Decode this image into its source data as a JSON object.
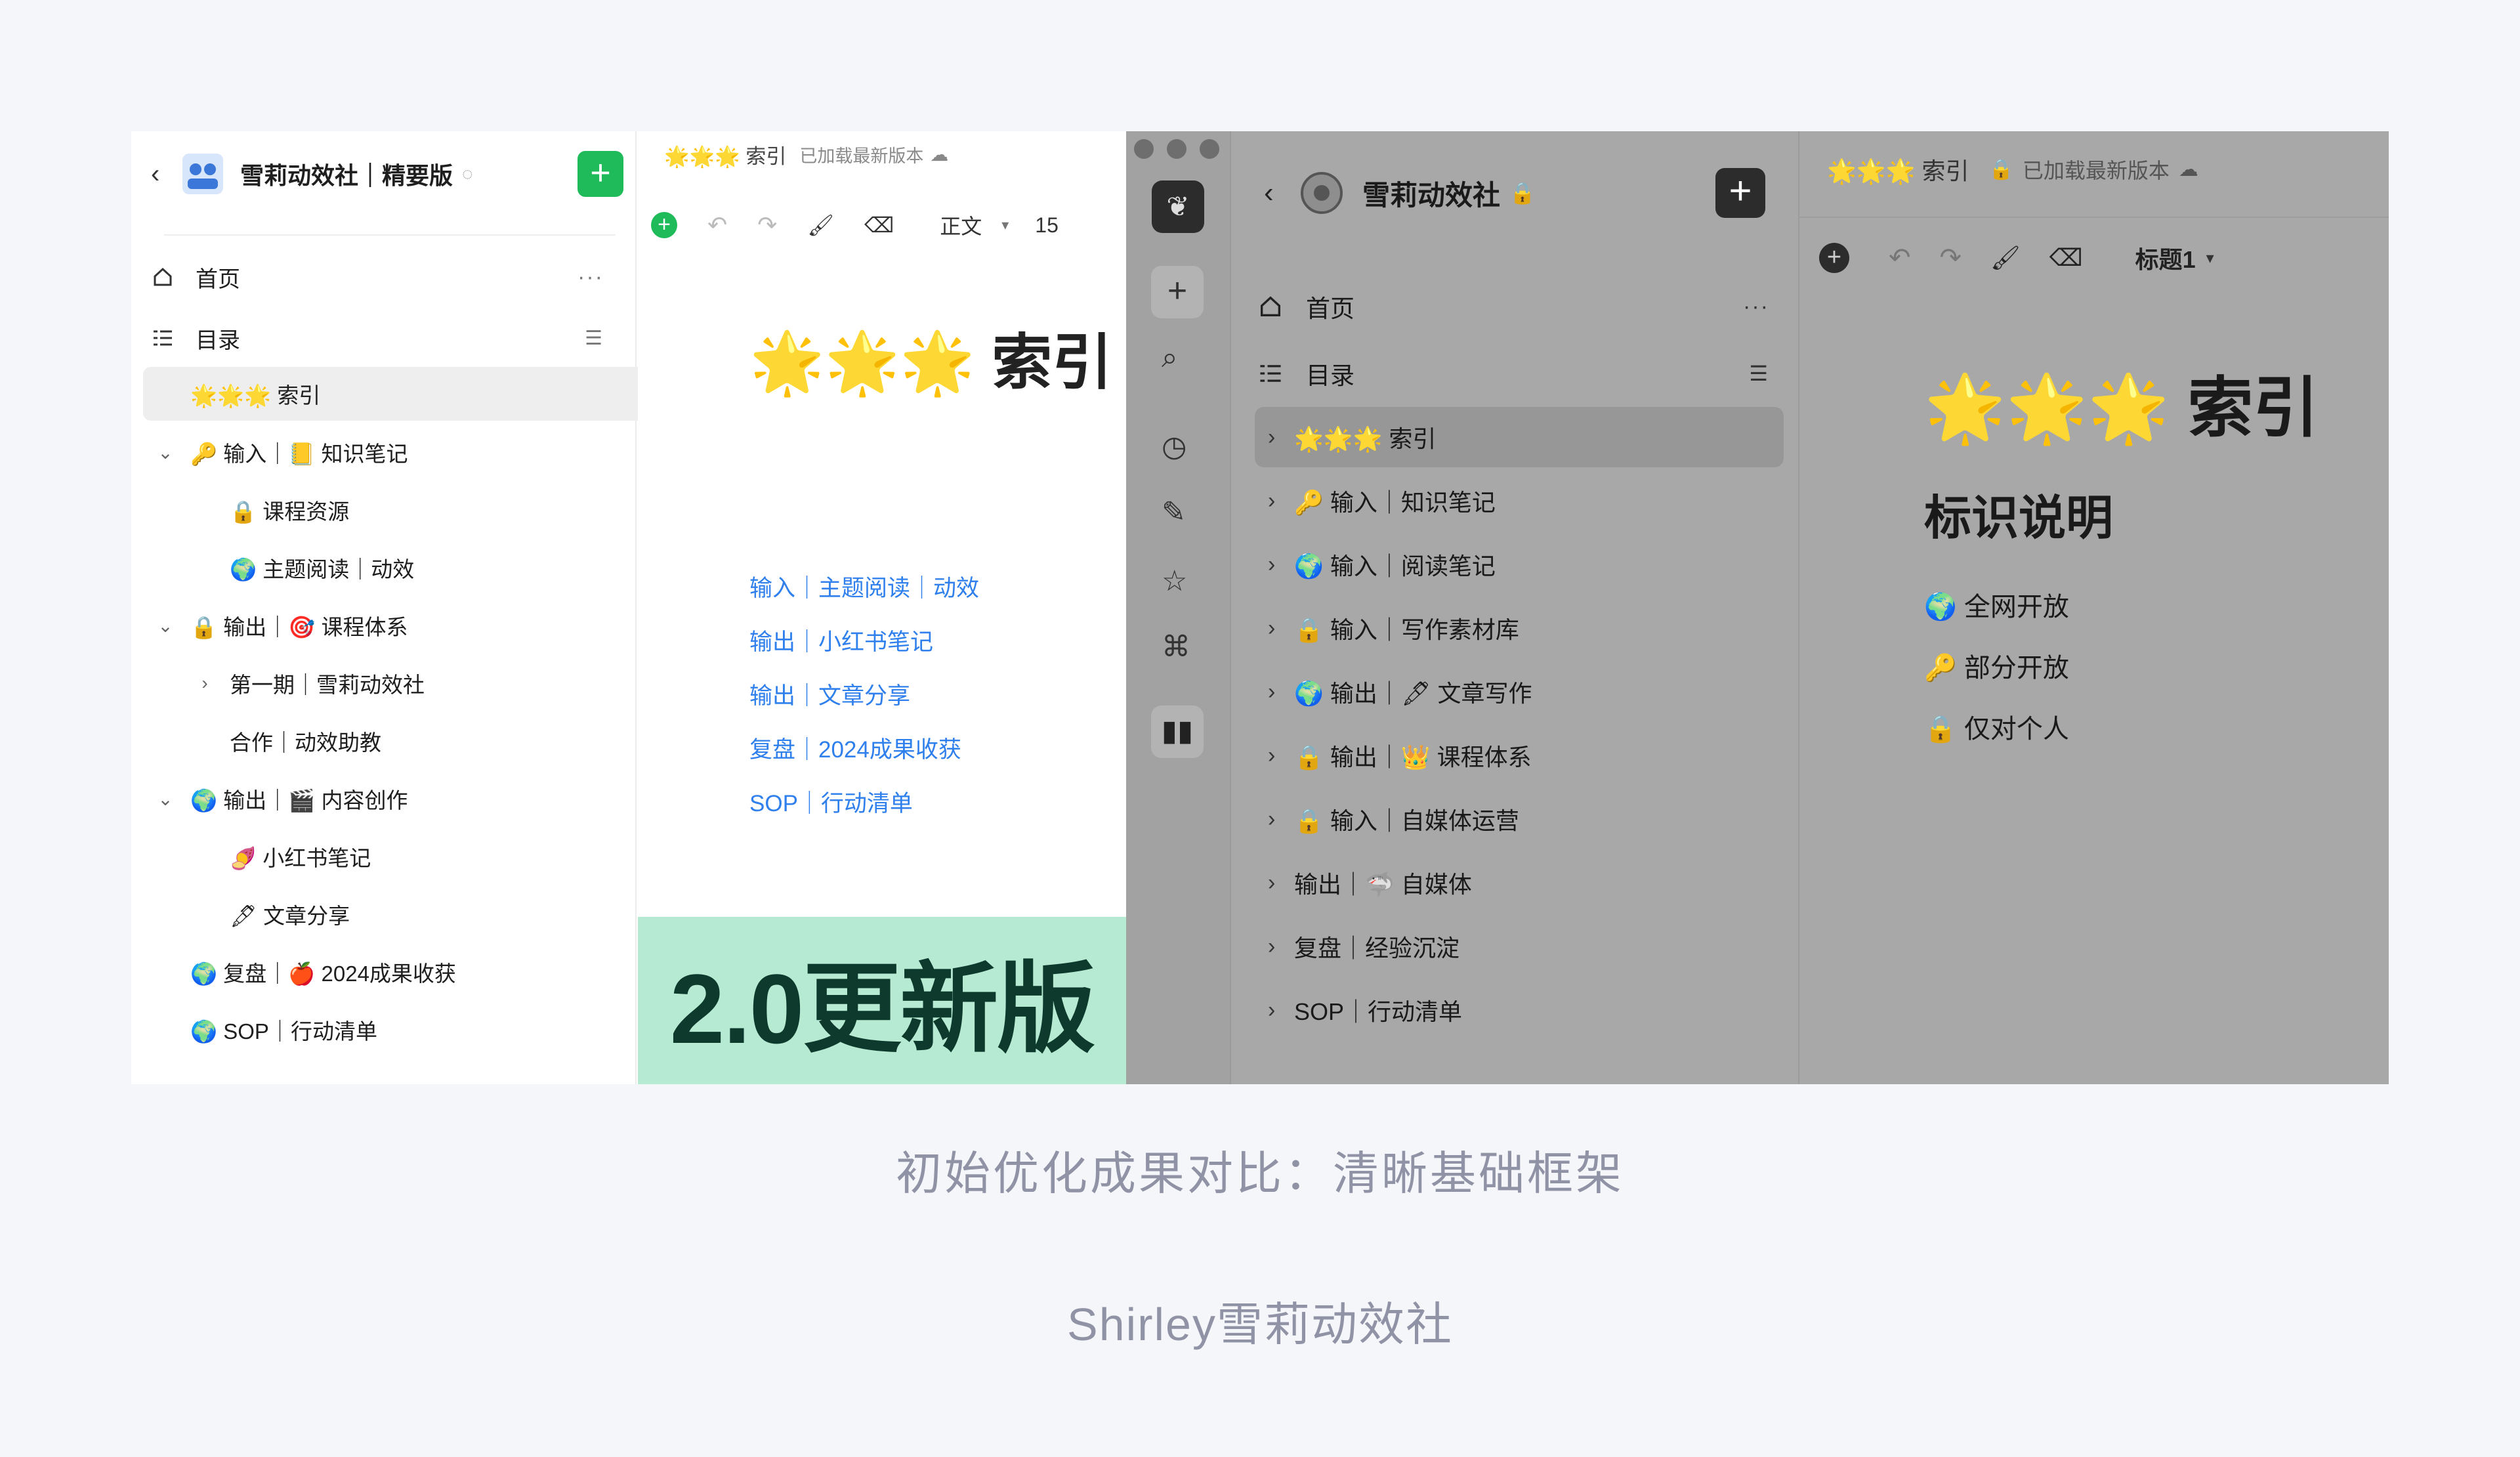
{
  "left_app": {
    "workspace_title": "雪莉动效社｜精要版",
    "nav": [
      {
        "label": "首页",
        "icon": "home-icon"
      },
      {
        "label": "目录",
        "icon": "toc-icon"
      }
    ],
    "tree": [
      {
        "label": "🌟🌟🌟 索引",
        "chev": ""
      },
      {
        "label": "🔑 输入｜📒 知识笔记",
        "chev": "⌄"
      },
      {
        "label": "🔒 课程资源",
        "chev": ""
      },
      {
        "label": "🌍 主题阅读｜动效",
        "chev": ""
      },
      {
        "label": "🔒 输出｜🎯 课程体系",
        "chev": "⌄"
      },
      {
        "label": "第一期｜雪莉动效社",
        "chev": "›"
      },
      {
        "label": "合作｜动效助教",
        "chev": ""
      },
      {
        "label": "🌍 输出｜🎬 内容创作",
        "chev": "⌄"
      },
      {
        "label": "🍠 小红书笔记",
        "chev": ""
      },
      {
        "label": "🖋 文章分享",
        "chev": ""
      },
      {
        "label": "🌍 复盘｜🍎 2024成果收获",
        "chev": ""
      },
      {
        "label": "🌍 SOP｜行动清单",
        "chev": ""
      }
    ],
    "doc": {
      "breadcrumb": "🌟🌟🌟 索引",
      "status": "已加载最新版本",
      "style_select": "正文",
      "font_size": "15",
      "heading": "🌟🌟🌟 索引",
      "links": [
        "输入｜主题阅读｜动效",
        "输出｜小红书笔记",
        "输出｜文章分享",
        "复盘｜2024成果收获",
        "SOP｜行动清单"
      ]
    },
    "badge": "2.0更新版"
  },
  "right_app": {
    "workspace_title": "雪莉动效社",
    "nav": [
      {
        "label": "首页",
        "icon": "home-icon"
      },
      {
        "label": "目录",
        "icon": "toc-icon"
      }
    ],
    "tree": [
      "🌟🌟🌟 索引",
      "🔑 输入｜知识笔记",
      "🌍 输入｜阅读笔记",
      "🔒 输入｜写作素材库",
      "🌍 输出｜🖋 文章写作",
      "🔒 输出｜👑 课程体系",
      "🔒 输入｜自媒体运营",
      "输出｜🦈 自媒体",
      "复盘｜经验沉淀",
      "SOP｜行动清单"
    ],
    "doc": {
      "breadcrumb": "🌟🌟🌟 索引",
      "status": "已加载最新版本",
      "style_select": "标题1",
      "heading": "🌟🌟🌟 索引",
      "subheading": "标识说明",
      "legend": [
        "🌍 全网开放",
        "🔑 部分开放",
        "🔒 仅对个人"
      ]
    }
  },
  "caption": "初始优化成果对比：清晰基础框架",
  "credit": "Shirley雪莉动效社",
  "colors": {
    "accent_green": "#1fbb5b",
    "link_blue": "#2f80ed",
    "badge_bg": "#b6ead3"
  }
}
